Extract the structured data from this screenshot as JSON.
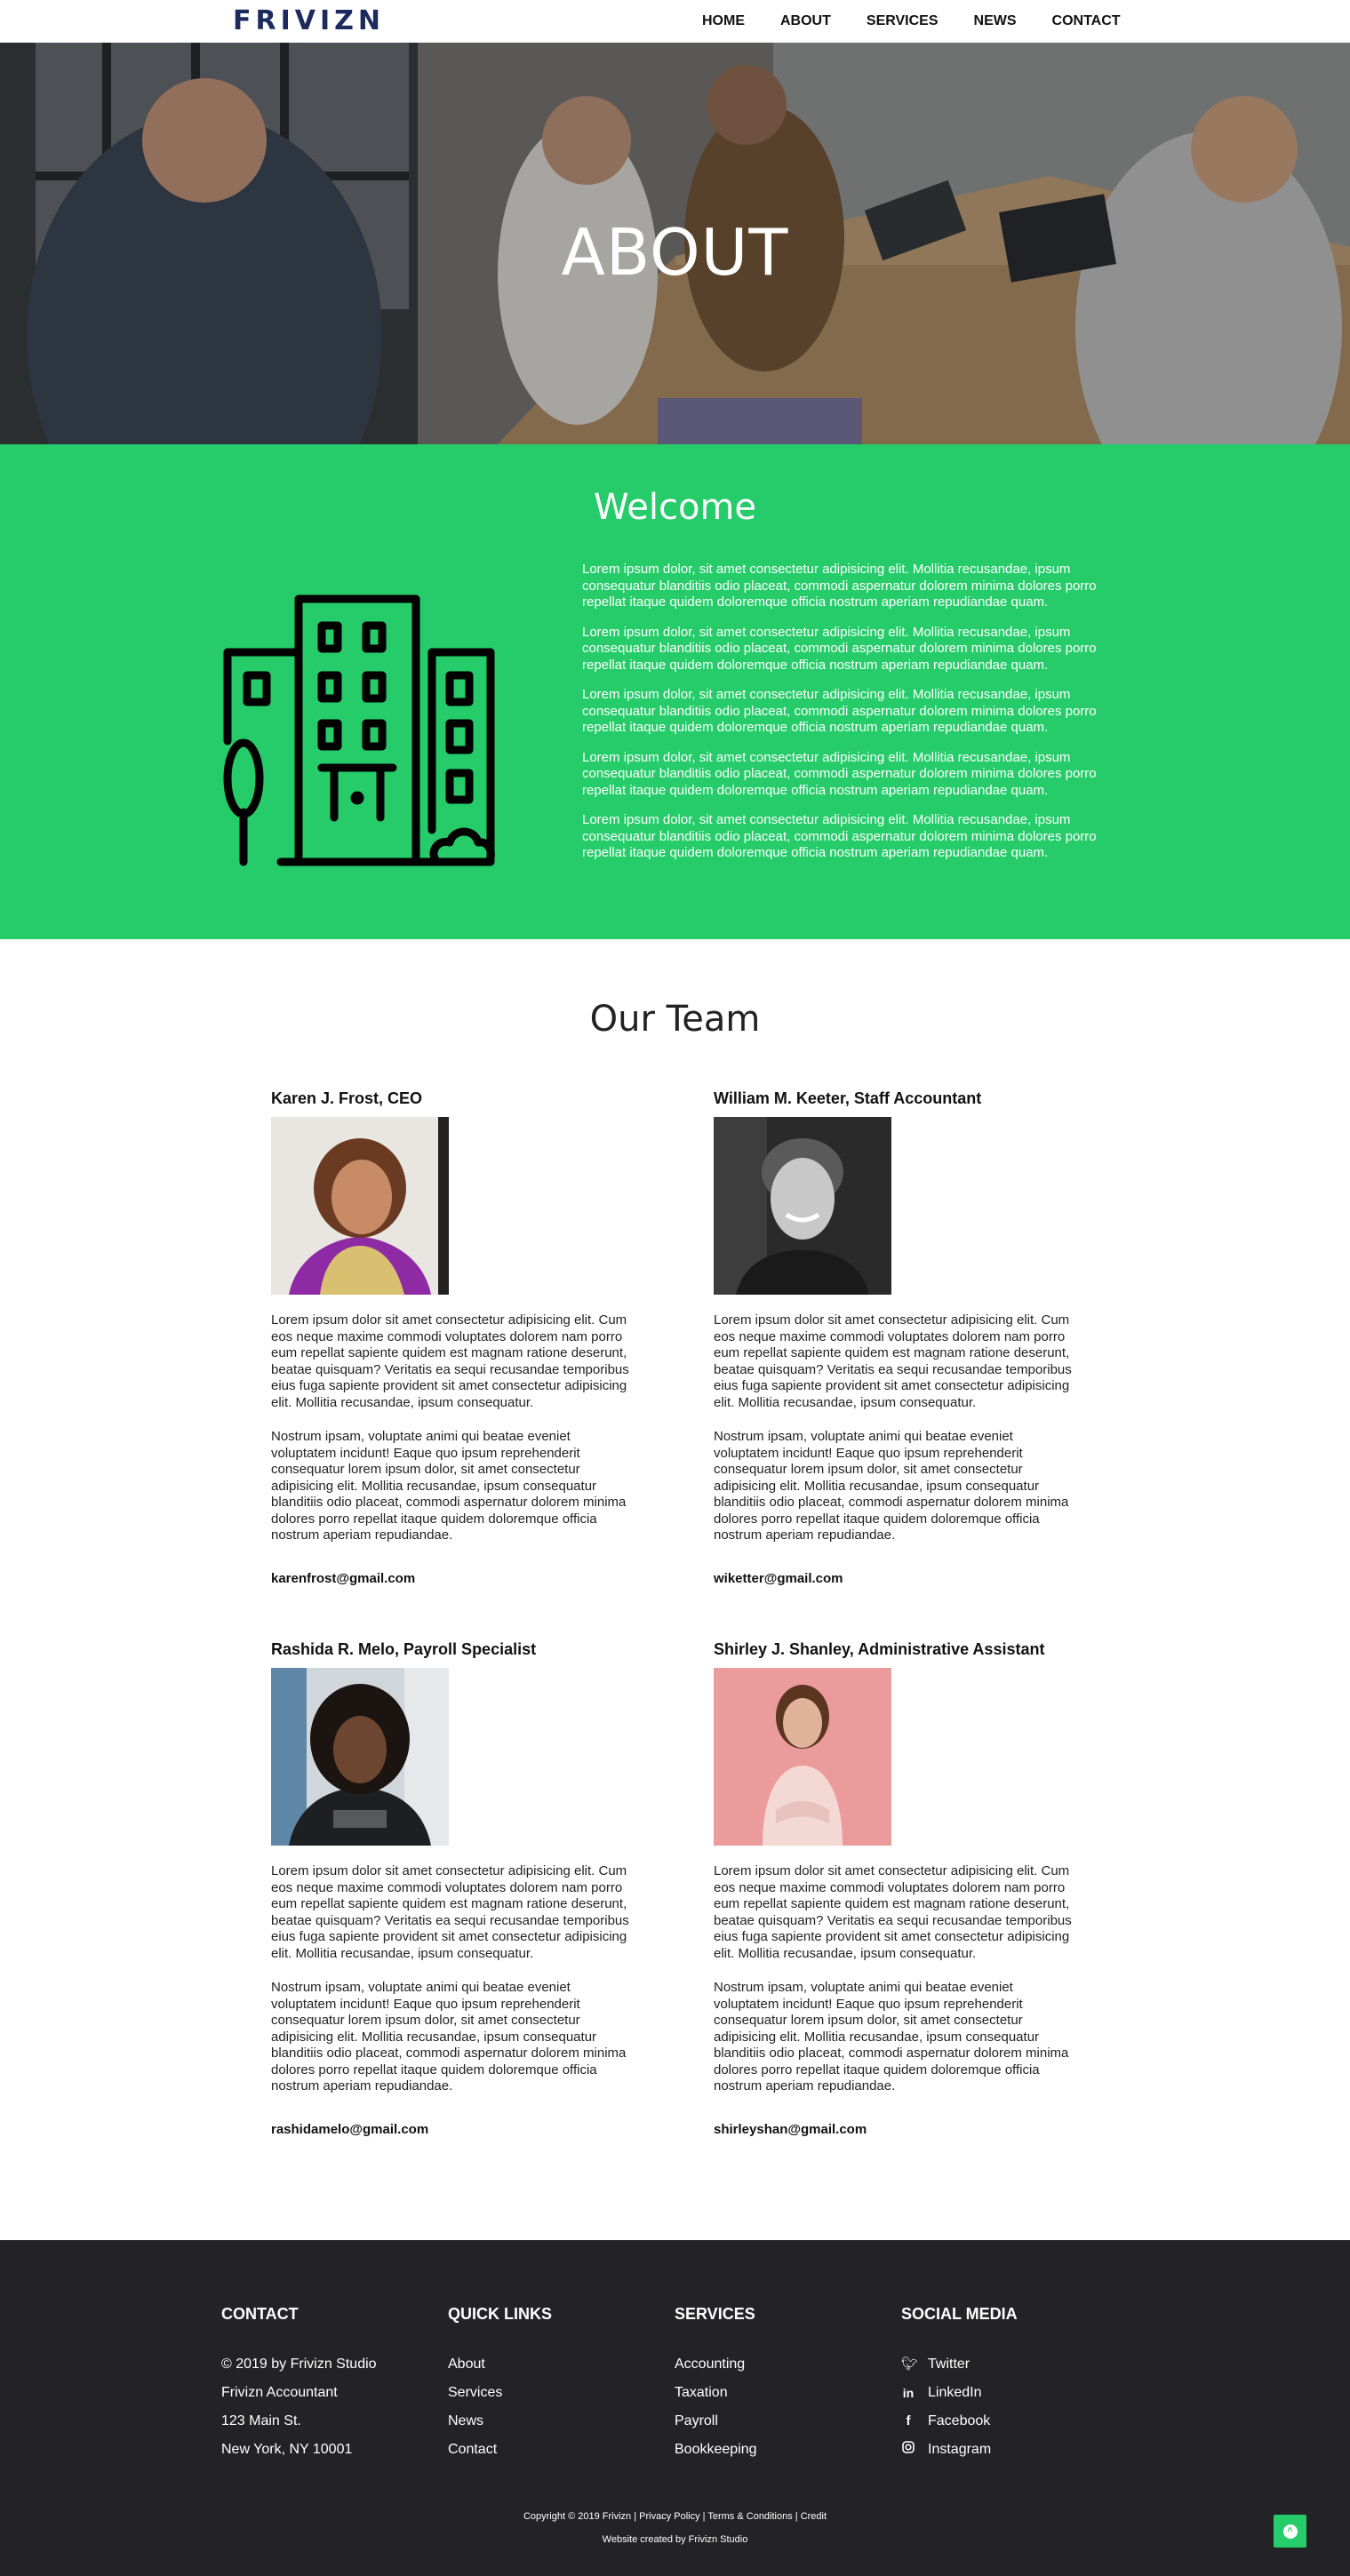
{
  "header": {
    "logo": "FRIVIZN",
    "nav": [
      "HOME",
      "ABOUT",
      "SERVICES",
      "NEWS",
      "CONTACT"
    ]
  },
  "hero": {
    "title": "ABOUT"
  },
  "welcome": {
    "title": "Welcome",
    "paragraphs": [
      "Lorem ipsum dolor, sit amet consectetur adipisicing elit. Mollitia recusandae, ipsum consequatur blanditiis odio placeat, commodi aspernatur dolorem minima dolores porro repellat itaque quidem doloremque officia nostrum aperiam repudiandae quam.",
      "Lorem ipsum dolor, sit amet consectetur adipisicing elit. Mollitia recusandae, ipsum consequatur blanditiis odio placeat, commodi aspernatur dolorem minima dolores porro repellat itaque quidem doloremque officia nostrum aperiam repudiandae quam.",
      "Lorem ipsum dolor, sit amet consectetur adipisicing elit. Mollitia recusandae, ipsum consequatur blanditiis odio placeat, commodi aspernatur dolorem minima dolores porro repellat itaque quidem doloremque officia nostrum aperiam repudiandae quam.",
      "Lorem ipsum dolor, sit amet consectetur adipisicing elit. Mollitia recusandae, ipsum consequatur blanditiis odio placeat, commodi aspernatur dolorem minima dolores porro repellat itaque quidem doloremque officia nostrum aperiam repudiandae quam.",
      "Lorem ipsum dolor, sit amet consectetur adipisicing elit. Mollitia recusandae, ipsum consequatur blanditiis odio placeat, commodi aspernatur dolorem minima dolores porro repellat itaque quidem doloremque officia nostrum aperiam repudiandae quam."
    ]
  },
  "team": {
    "title": "Our Team",
    "members": [
      {
        "name": "Karen J. Frost, CEO",
        "p1": "Lorem ipsum dolor sit amet consectetur adipisicing elit. Cum eos neque maxime commodi voluptates dolorem nam porro eum repellat sapiente quidem est magnam ratione deserunt, beatae quisquam? Veritatis ea sequi recusandae temporibus eius fuga sapiente provident sit amet consectetur adipisicing elit. Mollitia recusandae, ipsum consequatur.",
        "p2": "Nostrum ipsam, voluptate animi qui beatae eveniet voluptatem incidunt! Eaque quo ipsum reprehenderit consequatur lorem ipsum dolor, sit amet consectetur adipisicing elit. Mollitia recusandae, ipsum consequatur blanditiis odio placeat, commodi aspernatur dolorem minima dolores porro repellat itaque quidem doloremque officia nostrum aperiam repudiandae.",
        "email": "karenfrost@gmail.com"
      },
      {
        "name": "William M. Keeter, Staff Accountant",
        "p1": "Lorem ipsum dolor sit amet consectetur adipisicing elit. Cum eos neque maxime commodi voluptates dolorem nam porro eum repellat sapiente quidem est magnam ratione deserunt, beatae quisquam? Veritatis ea sequi recusandae temporibus eius fuga sapiente provident sit amet consectetur adipisicing elit. Mollitia recusandae, ipsum consequatur.",
        "p2": "Nostrum ipsam, voluptate animi qui beatae eveniet voluptatem incidunt! Eaque quo ipsum reprehenderit consequatur lorem ipsum dolor, sit amet consectetur adipisicing elit. Mollitia recusandae, ipsum consequatur blanditiis odio placeat, commodi aspernatur dolorem minima dolores porro repellat itaque quidem doloremque officia nostrum aperiam repudiandae.",
        "email": "wiketter@gmail.com"
      },
      {
        "name": "Rashida R. Melo, Payroll Specialist",
        "p1": "Lorem ipsum dolor sit amet consectetur adipisicing elit. Cum eos neque maxime commodi voluptates dolorem nam porro eum repellat sapiente quidem est magnam ratione deserunt, beatae quisquam? Veritatis ea sequi recusandae temporibus eius fuga sapiente provident sit amet consectetur adipisicing elit. Mollitia recusandae, ipsum consequatur.",
        "p2": "Nostrum ipsam, voluptate animi qui beatae eveniet voluptatem incidunt! Eaque quo ipsum reprehenderit consequatur lorem ipsum dolor, sit amet consectetur adipisicing elit. Mollitia recusandae, ipsum consequatur blanditiis odio placeat, commodi aspernatur dolorem minima dolores porro repellat itaque quidem doloremque officia nostrum aperiam repudiandae.",
        "email": "rashidamelo@gmail.com"
      },
      {
        "name": "Shirley J. Shanley, Administrative Assistant",
        "p1": "Lorem ipsum dolor sit amet consectetur adipisicing elit. Cum eos neque maxime commodi voluptates dolorem nam porro eum repellat sapiente quidem est magnam ratione deserunt, beatae quisquam? Veritatis ea sequi recusandae temporibus eius fuga sapiente provident sit amet consectetur adipisicing elit. Mollitia recusandae, ipsum consequatur.",
        "p2": "Nostrum ipsam, voluptate animi qui beatae eveniet voluptatem incidunt! Eaque quo ipsum reprehenderit consequatur lorem ipsum dolor, sit amet consectetur adipisicing elit. Mollitia recusandae, ipsum consequatur blanditiis odio placeat, commodi aspernatur dolorem minima dolores porro repellat itaque quidem doloremque officia nostrum aperiam repudiandae.",
        "email": "shirleyshan@gmail.com"
      }
    ]
  },
  "footer": {
    "contact": {
      "heading": "CONTACT",
      "lines": [
        "© 2019 by Frivizn Studio",
        "Frivizn Accountant",
        "123 Main St.",
        "New York, NY 10001"
      ]
    },
    "quick_links": {
      "heading": "QUICK LINKS",
      "items": [
        "About",
        "Services",
        "News",
        "Contact"
      ]
    },
    "services": {
      "heading": "SERVICES",
      "items": [
        "Accounting",
        "Taxation",
        "Payroll",
        "Bookkeeping"
      ]
    },
    "social": {
      "heading": "SOCIAL MEDIA",
      "items": [
        {
          "label": "Twitter",
          "icon": "twitter-icon"
        },
        {
          "label": "LinkedIn",
          "icon": "linkedin-icon"
        },
        {
          "label": "Facebook",
          "icon": "facebook-icon"
        },
        {
          "label": "Instagram",
          "icon": "instagram-icon"
        }
      ]
    },
    "copyright": "Copyright © 2019 Frivizn | Privacy Policy | Terms & Conditions | Credit",
    "credit": "Website created by Frivizn Studio"
  },
  "colors": {
    "accent": "#26cc6a",
    "logo": "#1c2a5e",
    "footer_bg": "#232325"
  }
}
